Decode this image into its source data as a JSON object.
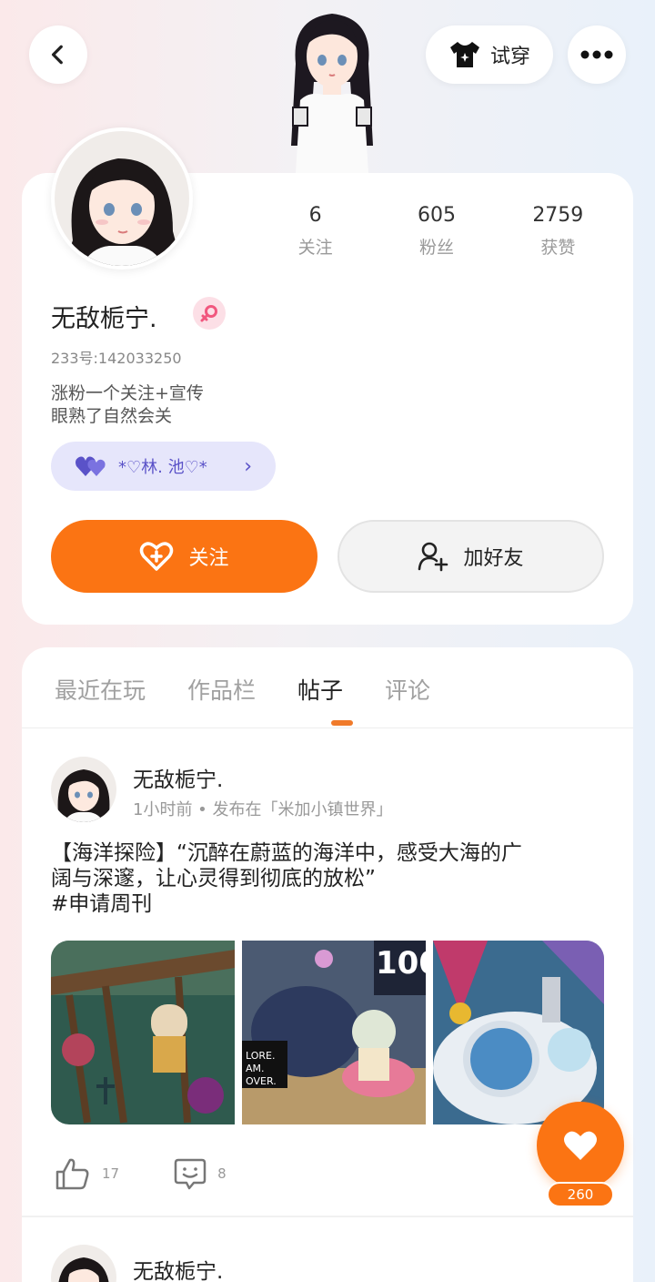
{
  "header": {
    "tryon_label": "试穿"
  },
  "stats": [
    {
      "value": "6",
      "label": "关注"
    },
    {
      "value": "605",
      "label": "粉丝"
    },
    {
      "value": "2759",
      "label": "获赞"
    }
  ],
  "profile": {
    "nickname": "无敌栀宁.",
    "uid": "233号:142033250",
    "bio_line1": "涨粉一个关注+宣传",
    "bio_line2": "眼熟了自然会关",
    "cp_tag": "*♡林. 池♡*"
  },
  "buttons": {
    "follow": "关注",
    "add_friend": "加好友"
  },
  "tabs": [
    {
      "label": "最近在玩"
    },
    {
      "label": "作品栏"
    },
    {
      "label": "帖子"
    },
    {
      "label": "评论"
    }
  ],
  "post": {
    "author": "无敌栀宁.",
    "meta": "1小时前 • 发布在「米加小镇世界」",
    "text_line1": "【海洋探险】“沉醉在蔚蓝的海洋中，感受大海的广",
    "text_line2": "阔与深邃，让心灵得到彻底的放松”",
    "hashtag": "#申请周刊",
    "likes": "17",
    "comments": "8"
  },
  "post2": {
    "author": "无敌栀宁."
  },
  "fab": {
    "count": "260"
  },
  "colors": {
    "accent": "#fb7413",
    "cp_bg": "#e6e6fb",
    "cp_text": "#5a52c8"
  }
}
